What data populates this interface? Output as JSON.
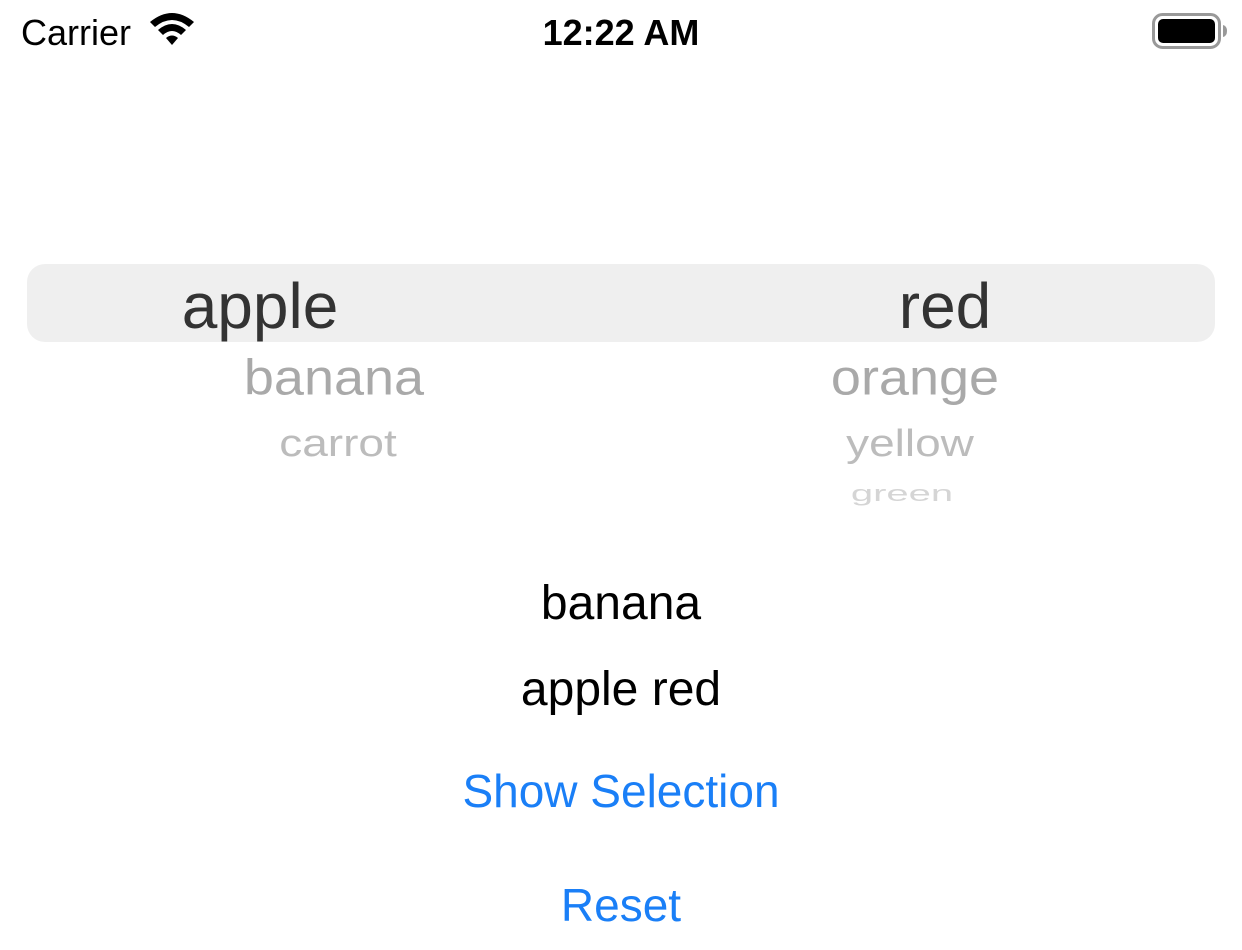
{
  "status_bar": {
    "carrier": "Carrier",
    "time": "12:22 AM",
    "wifi_icon": "wifi-icon",
    "battery_icon": "battery-icon"
  },
  "picker": {
    "left_column": {
      "selected": "apple",
      "rows": [
        "banana",
        "carrot"
      ]
    },
    "right_column": {
      "selected": "red",
      "rows": [
        "orange",
        "yellow",
        "green"
      ]
    },
    "highlight_color": "#efefef"
  },
  "labels": {
    "selection": "banana",
    "combination": "apple red"
  },
  "buttons": {
    "show_selection": "Show Selection",
    "reset": "Reset",
    "tint": "#1a7ff7"
  }
}
